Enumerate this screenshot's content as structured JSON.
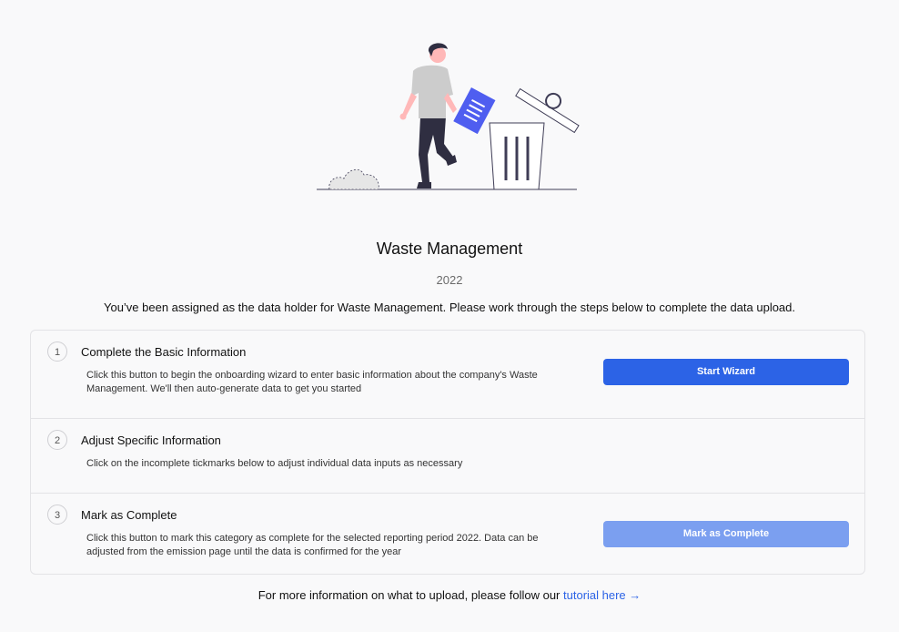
{
  "page": {
    "title": "Waste Management",
    "year": "2022",
    "intro": "You’ve been assigned as the data holder for Waste Management. Please work through the steps below to complete the data upload."
  },
  "steps": [
    {
      "number": "1",
      "title": "Complete the Basic Information",
      "description": "Click this button to begin the onboarding wizard to enter basic information about the company's Waste Management. We'll then auto-generate data to get you started",
      "button": "Start Wizard"
    },
    {
      "number": "2",
      "title": "Adjust Specific Information",
      "description": "Click on the incomplete tickmarks below to adjust individual data inputs as necessary"
    },
    {
      "number": "3",
      "title": "Mark as Complete",
      "description": "Click this button to mark this category as complete for the selected reporting period 2022. Data can be adjusted from the emission page until the data is confirmed for the year",
      "button": "Mark as Complete"
    }
  ],
  "footer": {
    "text": "For more information on what to upload, please follow our",
    "link": "tutorial here →"
  },
  "colors": {
    "primary": "#2c63e6",
    "primary_disabled": "#7b9ff0",
    "illustration_accent": "#4f5ef0"
  },
  "illustration": "person-throwing-document-in-trash"
}
